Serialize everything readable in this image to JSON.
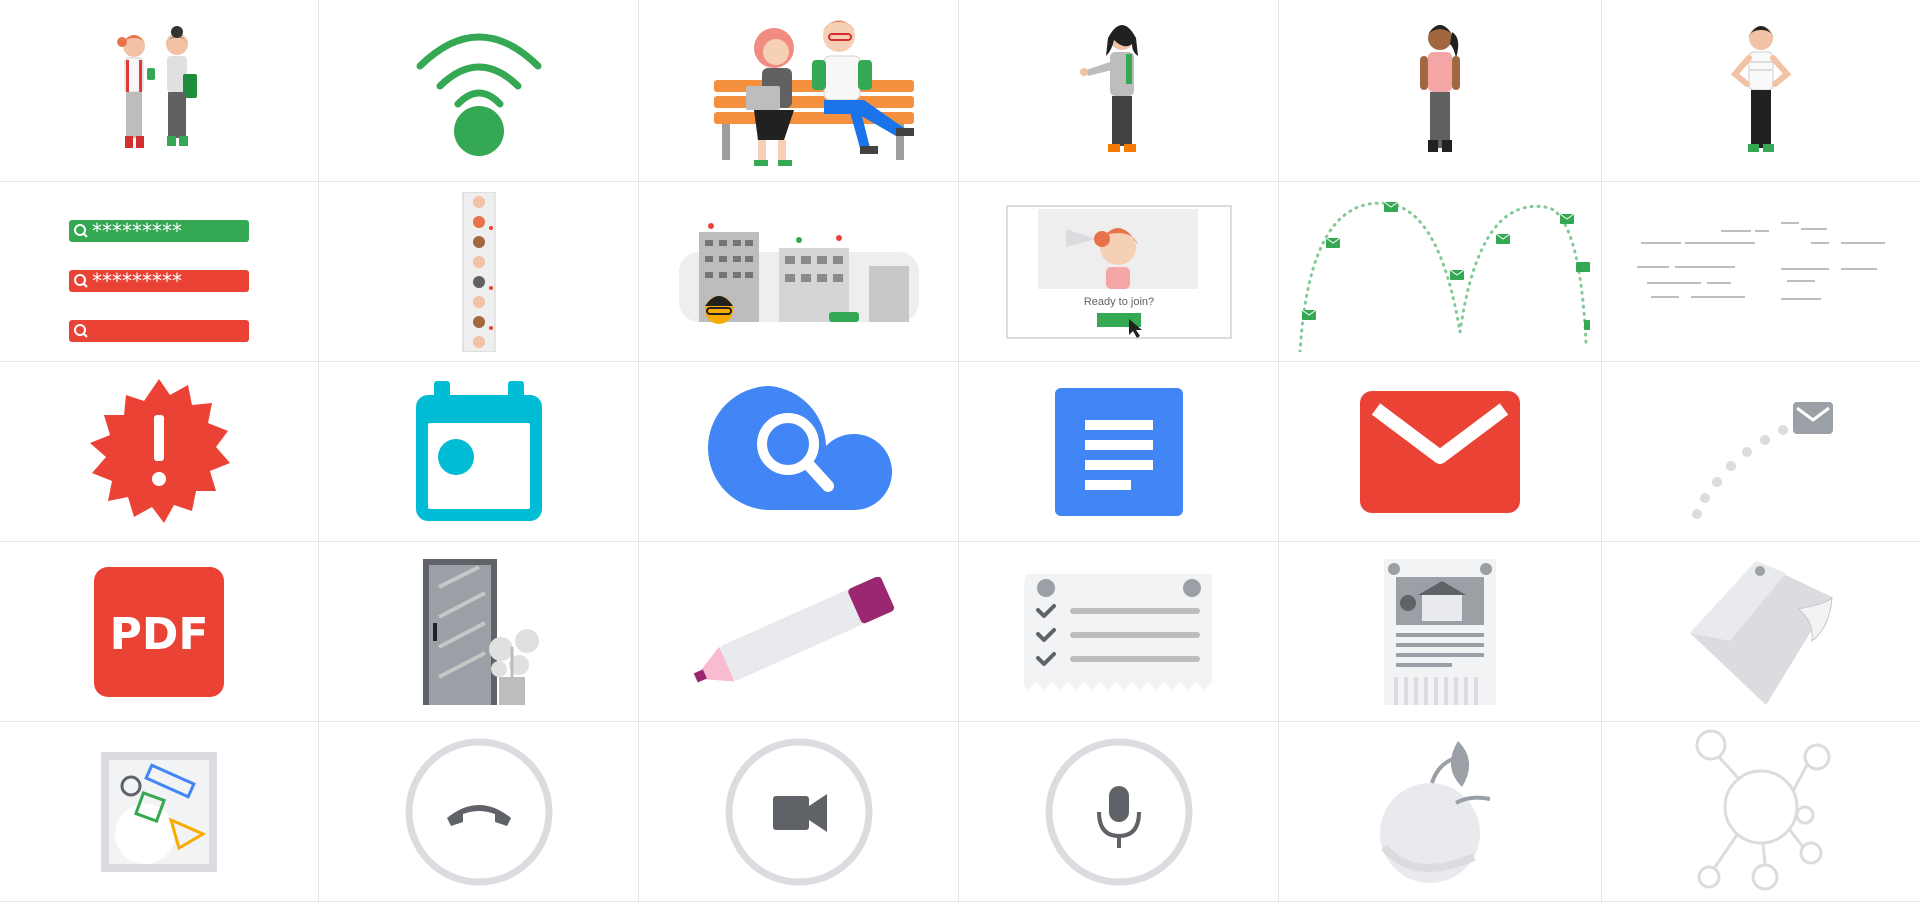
{
  "icons": [
    "people-chatting-illustration",
    "wifi-icon",
    "people-on-bench-illustration",
    "person-waving-illustration",
    "person-standing-illustration",
    "person-hands-on-hips-illustration",
    "password-search-fields-illustration",
    "participant-strip-illustration",
    "office-buildings-illustration",
    "ready-to-join-illustration",
    "bouncing-mail-path-illustration",
    "binary-data-illustration",
    "alert-badge-icon",
    "calendar-icon",
    "cloud-search-icon",
    "document-icon",
    "gmail-envelope-icon",
    "mail-trail-icon",
    "pdf-icon",
    "door-with-plant-illustration",
    "highlighter-icon",
    "checklist-receipt-icon",
    "newspaper-icon",
    "sticky-note-icon",
    "shapes-picture-icon",
    "hangup-phone-icon",
    "video-camera-icon",
    "microphone-icon",
    "apple-icon",
    "network-hub-icon"
  ],
  "meet": {
    "ready_text": "Ready to join?"
  },
  "colors": {
    "green": "#34a853",
    "red": "#ea4335",
    "blue": "#4285f4",
    "cyan": "#00bcd4",
    "grey": "#dadce0",
    "dark": "#5f6368"
  }
}
